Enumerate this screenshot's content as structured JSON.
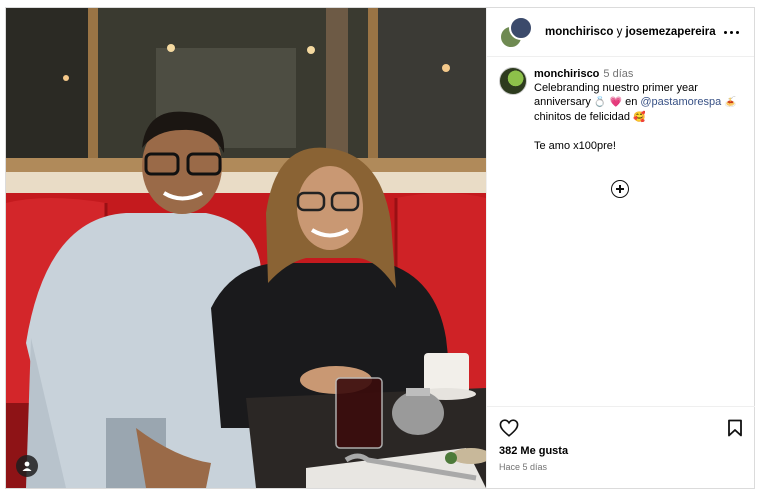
{
  "post": {
    "header": {
      "user1": "monchirisco",
      "separator": " y ",
      "user2": "josemezapereira",
      "more_icon": "more-horizontal-icon"
    },
    "caption": {
      "username": "monchirisco",
      "time": "5 días",
      "text_part1": "Celebranding nuestro primer year anniversary ",
      "emoji1": "💍 💗",
      "text_part2": " en ",
      "mention": "@pastamorespa",
      "emoji2": "🍝",
      "text_part3": " chinitos de felicidad ",
      "emoji3": "🥰",
      "extra_line": "Te amo x100pre!"
    },
    "add_comment_icon": "plus-circle-icon",
    "actions": {
      "like_icon": "heart-icon",
      "save_icon": "bookmark-icon",
      "likes_text": "382 Me gusta",
      "posted_ago": "Hace 5 días"
    },
    "photo": {
      "tag_icon": "user-tag-icon",
      "description_colors": {
        "booth_red": "#c8161c",
        "wall": "#7a5530",
        "window": "#2a2a22"
      }
    }
  }
}
